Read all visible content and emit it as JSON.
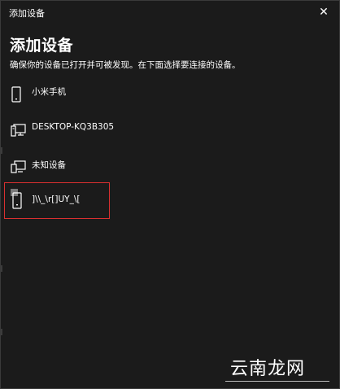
{
  "window": {
    "title": "添加设备",
    "close_glyph": "✕"
  },
  "main": {
    "heading": "添加设备",
    "subtitle": "确保你的设备已打开并可被发现。在下面选择要连接的设备。"
  },
  "devices": [
    {
      "label": "小米手机",
      "icon": "phone-icon"
    },
    {
      "label": "DESKTOP-KQ3B305",
      "icon": "computer-icon"
    },
    {
      "label": "未知设备",
      "icon": "unknown-device-icon"
    },
    {
      "label": "]\\\\_\\r[]UY_\\[",
      "icon": "phone-icon",
      "highlighted": true
    }
  ],
  "watermark": {
    "text": "云南龙网"
  },
  "colors": {
    "background": "#1b1b1b",
    "text": "#ffffff",
    "highlight_border": "#d93030"
  }
}
